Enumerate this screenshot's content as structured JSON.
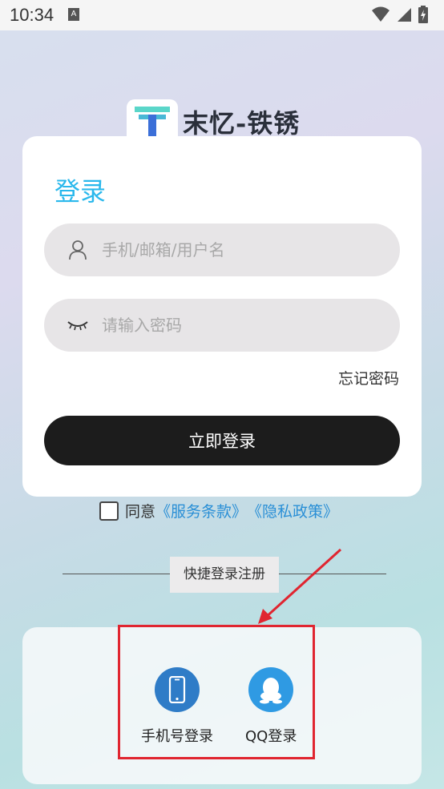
{
  "status_bar": {
    "time": "10:34",
    "notification_letter": "A"
  },
  "brand": {
    "name": "末忆-铁锈",
    "logo_letter": "T",
    "logo_colors": [
      "#5ad6c9",
      "#3b6fd8"
    ]
  },
  "login_card": {
    "title": "登录",
    "username_placeholder": "手机/邮箱/用户名",
    "password_placeholder": "请输入密码",
    "forgot_password": "忘记密码",
    "login_button": "立即登录"
  },
  "agreement": {
    "checked": false,
    "agree_text": "同意",
    "terms_link": "《服务条款》",
    "privacy_link": "《隐私政策》"
  },
  "quick_login": {
    "divider_label": "快捷登录注册",
    "options": [
      {
        "label": "手机号登录",
        "icon": "phone-icon",
        "color": "#2f7cc7"
      },
      {
        "label": "QQ登录",
        "icon": "qq-icon",
        "color": "#2f9ae3"
      }
    ]
  },
  "colors": {
    "accent_title": "#2ab8ec",
    "link": "#2a8fd6",
    "button": "#1c1c1c",
    "annotation": "#e02530"
  }
}
